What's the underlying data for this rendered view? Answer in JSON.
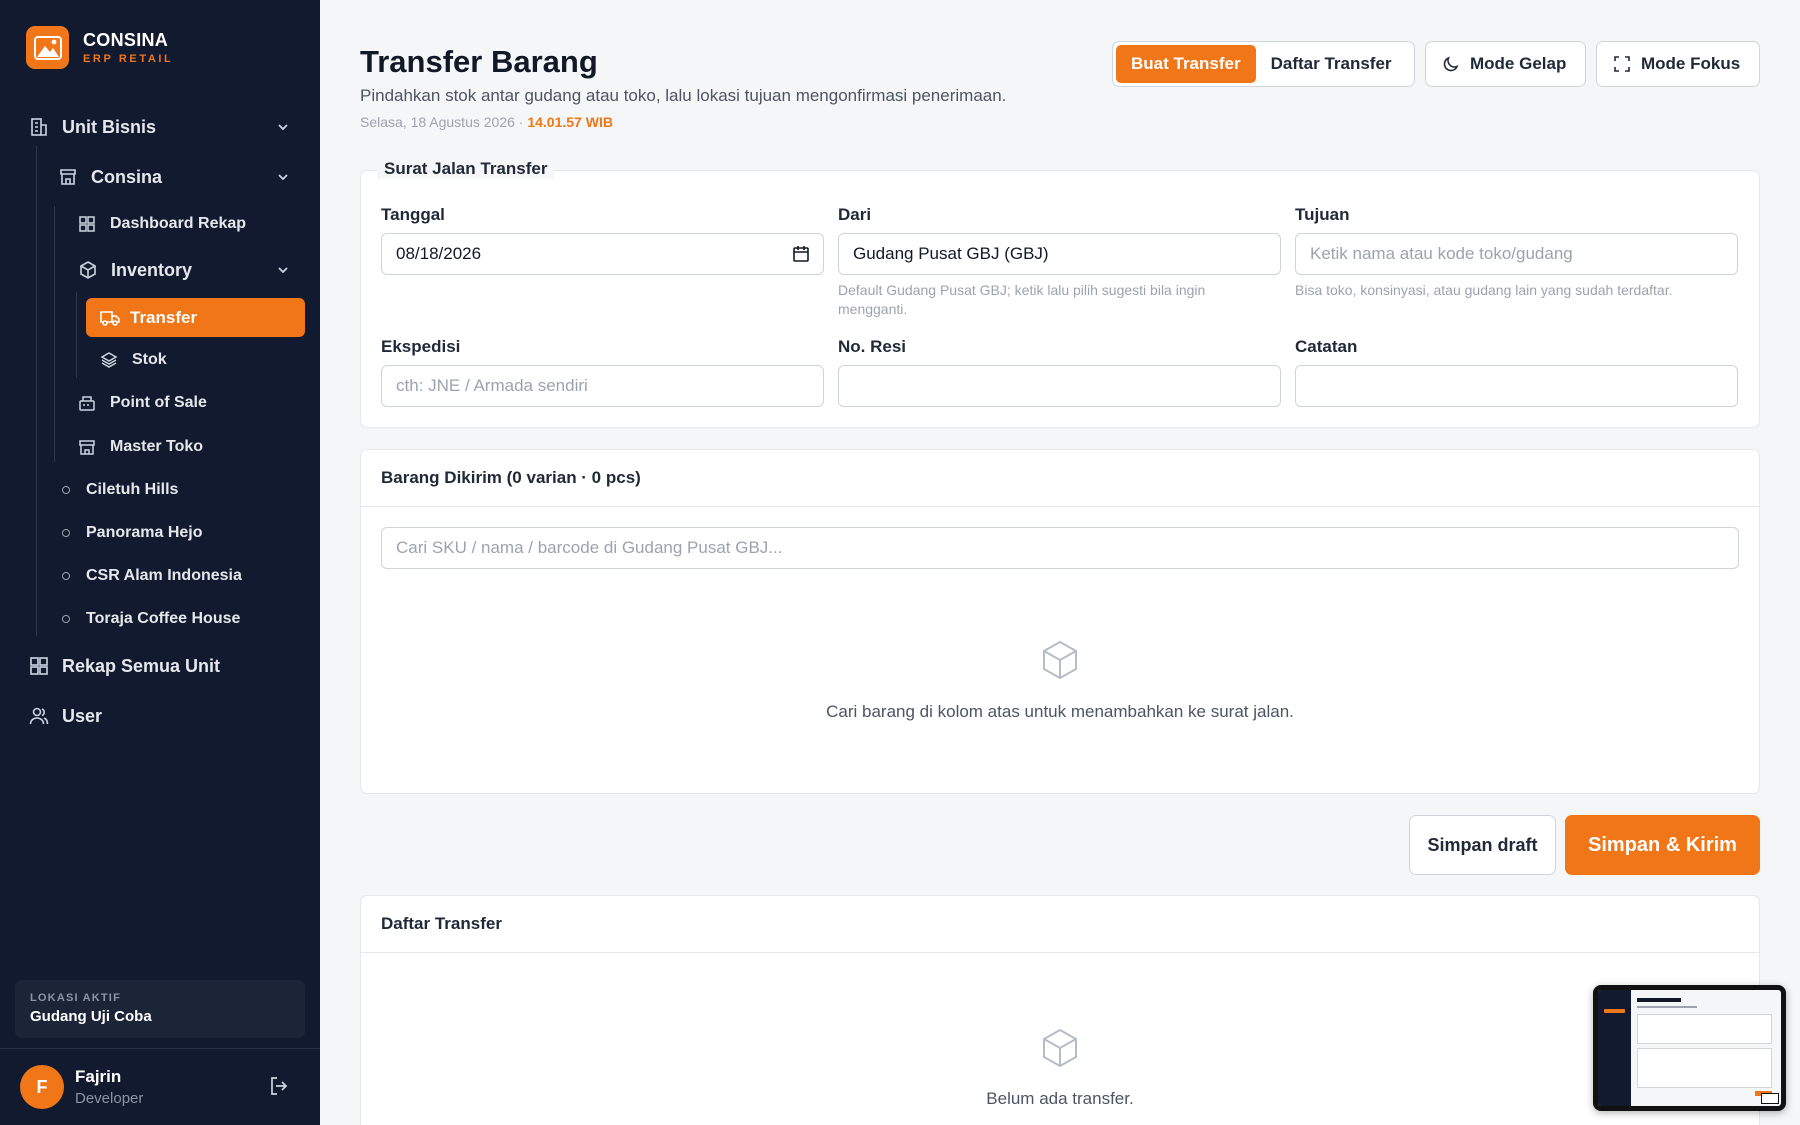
{
  "brand": {
    "name": "CONSINA",
    "subtitle": "ERP RETAIL"
  },
  "sidebar": {
    "unit_bisnis": "Unit Bisnis",
    "consina": "Consina",
    "dashboard_rekap": "Dashboard Rekap",
    "inventory": "Inventory",
    "transfer": "Transfer",
    "stok": "Stok",
    "point_of_sale": "Point of Sale",
    "master_toko": "Master Toko",
    "units": [
      "Ciletuh Hills",
      "Panorama Hejo",
      "CSR Alam Indonesia",
      "Toraja Coffee House"
    ],
    "rekap_semua_unit": "Rekap Semua Unit",
    "user": "User",
    "location_label": "LOKASI AKTIF",
    "location_value": "Gudang Uji Coba",
    "user_name": "Fajrin",
    "user_role": "Developer",
    "user_initial": "F"
  },
  "header": {
    "title": "Transfer Barang",
    "subtitle": "Pindahkan stok antar gudang atau toko, lalu lokasi tujuan mengonfirmasi penerimaan.",
    "date": "Selasa, 18 Agustus 2026 ·",
    "time": "14.01.57 WIB",
    "tab_create": "Buat Transfer",
    "tab_list": "Daftar Transfer",
    "dark_mode": "Mode Gelap",
    "focus_mode": "Mode Fokus"
  },
  "form": {
    "legend": "Surat Jalan Transfer",
    "tanggal_label": "Tanggal",
    "tanggal_value": "08/18/2026",
    "dari_label": "Dari",
    "dari_value": "Gudang Pusat GBJ (GBJ)",
    "dari_help": "Default Gudang Pusat GBJ; ketik lalu pilih sugesti bila ingin mengganti.",
    "tujuan_label": "Tujuan",
    "tujuan_placeholder": "Ketik nama atau kode toko/gudang",
    "tujuan_help": "Bisa toko, konsinyasi, atau gudang lain yang sudah terdaftar.",
    "ekspedisi_label": "Ekspedisi",
    "ekspedisi_placeholder": "cth: JNE / Armada sendiri",
    "resi_label": "No. Resi",
    "resi_value": "",
    "catatan_label": "Catatan",
    "catatan_value": ""
  },
  "items": {
    "title": "Barang Dikirim (0 varian · 0 pcs)",
    "search_placeholder": "Cari SKU / nama / barcode di Gudang Pusat GBJ...",
    "empty_text": "Cari barang di kolom atas untuk menambahkan ke surat jalan."
  },
  "actions": {
    "draft": "Simpan draft",
    "send": "Simpan & Kirim"
  },
  "list": {
    "title": "Daftar Transfer",
    "empty_text": "Belum ada transfer."
  },
  "colors": {
    "accent": "#f07618",
    "sidebar_bg": "#111a2e"
  },
  "icons": [
    "building-icon",
    "store-icon",
    "grid-icon",
    "box-icon",
    "truck-icon",
    "layers-icon",
    "register-icon",
    "users-icon",
    "moon-icon",
    "expand-icon",
    "calendar-icon",
    "logout-icon",
    "chevron-down-icon"
  ]
}
